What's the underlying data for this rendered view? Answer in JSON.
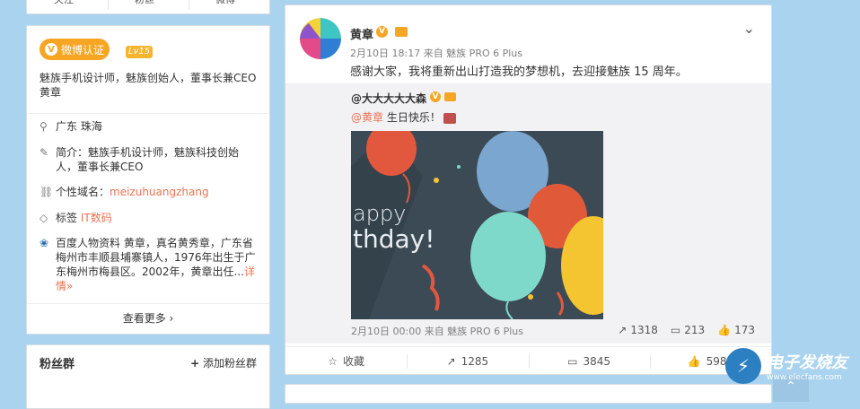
{
  "left_top": {
    "items": [
      "关注",
      "粉丝",
      "微博"
    ]
  },
  "profile": {
    "badge": "微博认证",
    "level": "Lv15",
    "bio": "魅族手机设计师，魅族创始人，董事长兼CEO 黄章",
    "location": "广东 珠海",
    "intro_label": "简介：",
    "intro_value": "魅族手机设计师，魅族科技创始人，董事长兼CEO",
    "domain_label": "个性域名：",
    "domain_value": "meizuhuangzhang",
    "tag_label": "标签",
    "tag_value": "IT数码",
    "baike_text": "百度人物资料 黄章，真名黄秀章，广东省梅州市丰顺县埔寨镇人，1976年出生于广东梅州市梅县区。2002年，黄章出任...",
    "baike_more": "详情»",
    "view_more": "查看更多 ›"
  },
  "fans": {
    "title": "粉丝群",
    "add": "添加粉丝群"
  },
  "post": {
    "author": "黄章",
    "time": "2月10日 18:17 来自 魅族 PRO 6 Plus",
    "content": "感谢大家，我将重新出山打造我的梦想机，去迎接魅族 15 周年。",
    "repost": {
      "author": "@大大大大大森",
      "mention": "@黄章",
      "text": " 生日快乐！",
      "photo_text_1": "appy",
      "photo_text_2": "thday!",
      "meta": "2月10日 00:00 来自 魅族 PRO 6 Plus",
      "forward_count": "1318",
      "comment_count": "213",
      "like_count": "173"
    },
    "actions": {
      "favorite": "收藏",
      "forward": "1285",
      "comment": "3845",
      "like": "5989"
    }
  },
  "watermark": {
    "brand": "电子发烧友",
    "url": "www.elecfans.com"
  }
}
